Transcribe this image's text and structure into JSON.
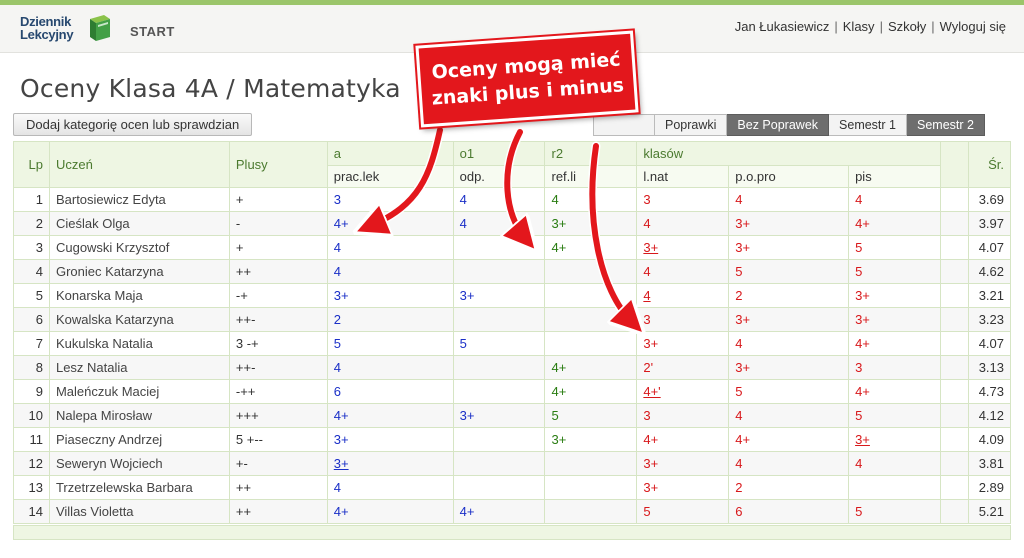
{
  "header": {
    "logo_line1": "Dziennik",
    "logo_line2": "Lekcyjny",
    "start": "START",
    "user": "Jan Łukasiewicz",
    "nav": [
      "Klasy",
      "Szkoły",
      "Wyloguj się"
    ],
    "accent": "#9bc56a"
  },
  "page": {
    "title": "Oceny Klasa 4A / Matematyka",
    "add_button": "Dodaj kategorię ocen lub sprawdzian"
  },
  "filters": [
    "Poprawki",
    "Bez Poprawek",
    "Semestr 1",
    "Semestr 2"
  ],
  "callout": {
    "line1": "Oceny mogą mieć",
    "line2": "znaki plus i minus",
    "color": "#e3171c"
  },
  "table": {
    "headers": {
      "lp": "Lp",
      "name": "Uczeń",
      "plus": "Plusy",
      "avg": "Śr.",
      "groups": [
        "a",
        "o1",
        "r2",
        "klasów"
      ],
      "categories": [
        "prac.lek",
        "odp.",
        "ref.li",
        "l.nat",
        "p.o.pro",
        "pis"
      ]
    },
    "rows": [
      {
        "lp": "1",
        "name": "Bartosiewicz Edyta",
        "plus": "+",
        "g": [
          "3",
          "4",
          "4",
          "3",
          "4",
          "4"
        ],
        "avg": "3.69"
      },
      {
        "lp": "2",
        "name": "Cieślak Olga",
        "plus": "-",
        "g": [
          "4+",
          "4",
          "3+",
          "4",
          "3+",
          "4+"
        ],
        "avg": "3.97"
      },
      {
        "lp": "3",
        "name": "Cugowski Krzysztof",
        "plus": "+",
        "g": [
          "4",
          "",
          "4+",
          "3+",
          "3+",
          "5"
        ],
        "avg": "4.07"
      },
      {
        "lp": "4",
        "name": "Groniec Katarzyna",
        "plus": "++",
        "g": [
          "4",
          "",
          "",
          "4",
          "5",
          "5"
        ],
        "avg": "4.62"
      },
      {
        "lp": "5",
        "name": "Konarska Maja",
        "plus": "-+",
        "g": [
          "3+",
          "3+",
          "",
          "4",
          "2",
          "3+"
        ],
        "avg": "3.21"
      },
      {
        "lp": "6",
        "name": "Kowalska Katarzyna",
        "plus": "++-",
        "g": [
          "2",
          "",
          "",
          "3",
          "3+",
          "3+"
        ],
        "avg": "3.23"
      },
      {
        "lp": "7",
        "name": "Kukulska Natalia",
        "plus": "3    -+",
        "g": [
          "5",
          "5",
          "",
          "3+",
          "4",
          "4+"
        ],
        "avg": "4.07"
      },
      {
        "lp": "8",
        "name": "Lesz Natalia",
        "plus": "++-",
        "g": [
          "4",
          "",
          "4+",
          "2'",
          "3+",
          "3"
        ],
        "avg": "3.13"
      },
      {
        "lp": "9",
        "name": "Maleńczuk Maciej",
        "plus": "-++",
        "g": [
          "6",
          "",
          "4+",
          "4+'",
          "5",
          "4+"
        ],
        "avg": "4.73"
      },
      {
        "lp": "10",
        "name": "Nalepa Mirosław",
        "plus": "+++",
        "g": [
          "4+",
          "3+",
          "5",
          "3",
          "4",
          "5"
        ],
        "avg": "4.12"
      },
      {
        "lp": "11",
        "name": "Piaseczny Andrzej",
        "plus": "5    +--",
        "g": [
          "3+",
          "",
          "3+",
          "4+",
          "4+",
          "3+"
        ],
        "avg": "4.09"
      },
      {
        "lp": "12",
        "name": "Seweryn Wojciech",
        "plus": "+-",
        "g": [
          "3+",
          "",
          "",
          "3+",
          "4",
          "4"
        ],
        "avg": "3.81"
      },
      {
        "lp": "13",
        "name": "Trzetrzelewska Barbara",
        "plus": "++",
        "g": [
          "4",
          "",
          "",
          "3+",
          "2",
          ""
        ],
        "avg": "2.89"
      },
      {
        "lp": "14",
        "name": "Villas Violetta",
        "plus": "++",
        "g": [
          "4+",
          "4+",
          "",
          "5",
          "6",
          "5"
        ],
        "avg": "5.21"
      }
    ],
    "grade_colors": {
      "blue": "#1a2fc7",
      "green": "#2a7d12",
      "red": "#d8181b"
    }
  }
}
